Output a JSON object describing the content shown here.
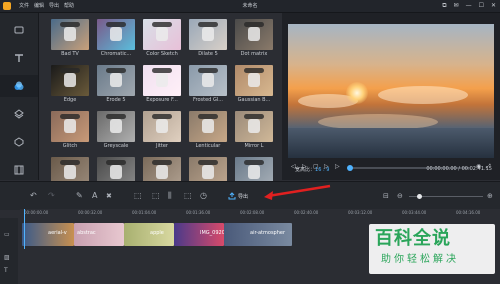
{
  "menu": [
    "文件",
    "编辑",
    "导出",
    "帮助"
  ],
  "window_title": "未命名",
  "window_controls": [
    "⧉",
    "✉",
    "—",
    "☐",
    "✕"
  ],
  "sidebar": {
    "items": [
      {
        "name": "media",
        "icon": "film-icon",
        "glyph": "▢"
      },
      {
        "name": "text",
        "icon": "text-icon",
        "glyph": "T"
      },
      {
        "name": "filters",
        "icon": "filters-icon",
        "glyph": "●"
      },
      {
        "name": "overlay",
        "icon": "layers-icon",
        "glyph": "◈"
      },
      {
        "name": "elements",
        "icon": "elements-icon",
        "glyph": "⬡"
      },
      {
        "name": "transition",
        "icon": "transition-icon",
        "glyph": "▣"
      }
    ]
  },
  "filters": [
    {
      "label": "Bad TV",
      "colors": [
        "#4a6b8a",
        "#c9a07a"
      ]
    },
    {
      "label": "Chromatic...",
      "colors": [
        "#7a5a8a",
        "#5abedc"
      ]
    },
    {
      "label": "Color Sketch",
      "colors": [
        "#d8e0e8",
        "#e8c0d8"
      ]
    },
    {
      "label": "Dilate 5",
      "colors": [
        "#9aa8b8",
        "#d8d0c8"
      ]
    },
    {
      "label": "Dot matrix",
      "colors": [
        "#4a4a4a",
        "#8a7a6a"
      ]
    },
    {
      "label": "Edge",
      "colors": [
        "#1a1a1a",
        "#6a5a3a"
      ]
    },
    {
      "label": "Erode 5",
      "colors": [
        "#6a7a8a",
        "#a0a8b0"
      ]
    },
    {
      "label": "Exposure F...",
      "colors": [
        "#f0e0f0",
        "#fff0f8"
      ]
    },
    {
      "label": "Frosted Gl...",
      "colors": [
        "#8a9aaa",
        "#b8c0c8"
      ]
    },
    {
      "label": "Gaussian B...",
      "colors": [
        "#b08a6a",
        "#d8b890"
      ]
    },
    {
      "label": "Glitch",
      "colors": [
        "#8a6a5a",
        "#c89a78"
      ]
    },
    {
      "label": "Greyscale",
      "colors": [
        "#6a6a6a",
        "#b0b0b0"
      ]
    },
    {
      "label": "Jitter",
      "colors": [
        "#b0a090",
        "#e0d0c0"
      ]
    },
    {
      "label": "Lenticular",
      "colors": [
        "#8a7a6a",
        "#c8a888"
      ]
    },
    {
      "label": "Mirror L",
      "colors": [
        "#9a8a7a",
        "#d0b898"
      ]
    },
    {
      "label": "",
      "colors": [
        "#6a5a4a",
        "#9a8a7a"
      ]
    },
    {
      "label": "",
      "colors": [
        "#4a4a4a",
        "#8a8a8a"
      ]
    },
    {
      "label": "",
      "colors": [
        "#7a6a5a",
        "#b0a090"
      ]
    },
    {
      "label": "",
      "colors": [
        "#8a7a6a",
        "#c0a890"
      ]
    },
    {
      "label": "",
      "colors": [
        "#6a7a8a",
        "#a8b0b8"
      ]
    }
  ],
  "preview": {
    "ratio_label": "宽高比：",
    "ratio_value": "16 : 9",
    "time": "00:00:00.00 / 00:02:41.15",
    "controls": [
      "◁",
      "▷",
      "▢",
      "▷",
      "▷"
    ]
  },
  "toolbar": {
    "undo": "↶",
    "redo": "↷",
    "pencil": "✎",
    "text": "A",
    "delete": "🗑",
    "crop": "⬚",
    "resize": "⬚",
    "split": "⫼",
    "fit": "⬚",
    "clock": "◷",
    "export_label": "导出",
    "tooltip": "导出"
  },
  "ruler": [
    "00:00:00.00",
    "00:00:32.00",
    "00:01:04.00",
    "00:01:36.00",
    "00:02:08.00",
    "00:02:40.00",
    "00:03:12.00",
    "00:03:44.00",
    "00:04:16.00"
  ],
  "clips": [
    {
      "label": "aerial-v",
      "colors": [
        "#3a5a8a",
        "#c89050"
      ]
    },
    {
      "label": "abstrac",
      "colors": [
        "#c8a0b0",
        "#e8c8d0"
      ]
    },
    {
      "label": "apple",
      "colors": [
        "#a8b070",
        "#d8d8a0"
      ]
    },
    {
      "label": "IMG_092001",
      "colors": [
        "#4a3a8a",
        "#d84a6a"
      ]
    },
    {
      "label": "air-atmospher",
      "colors": [
        "#4a5a7a",
        "#7a8aa0"
      ]
    }
  ],
  "watermark": {
    "title": "百科全说",
    "subtitle": "助你轻松解决"
  },
  "colors": {
    "accent": "#4fb3ff",
    "arrow": "#e02020",
    "brand": "#2aa55a"
  }
}
